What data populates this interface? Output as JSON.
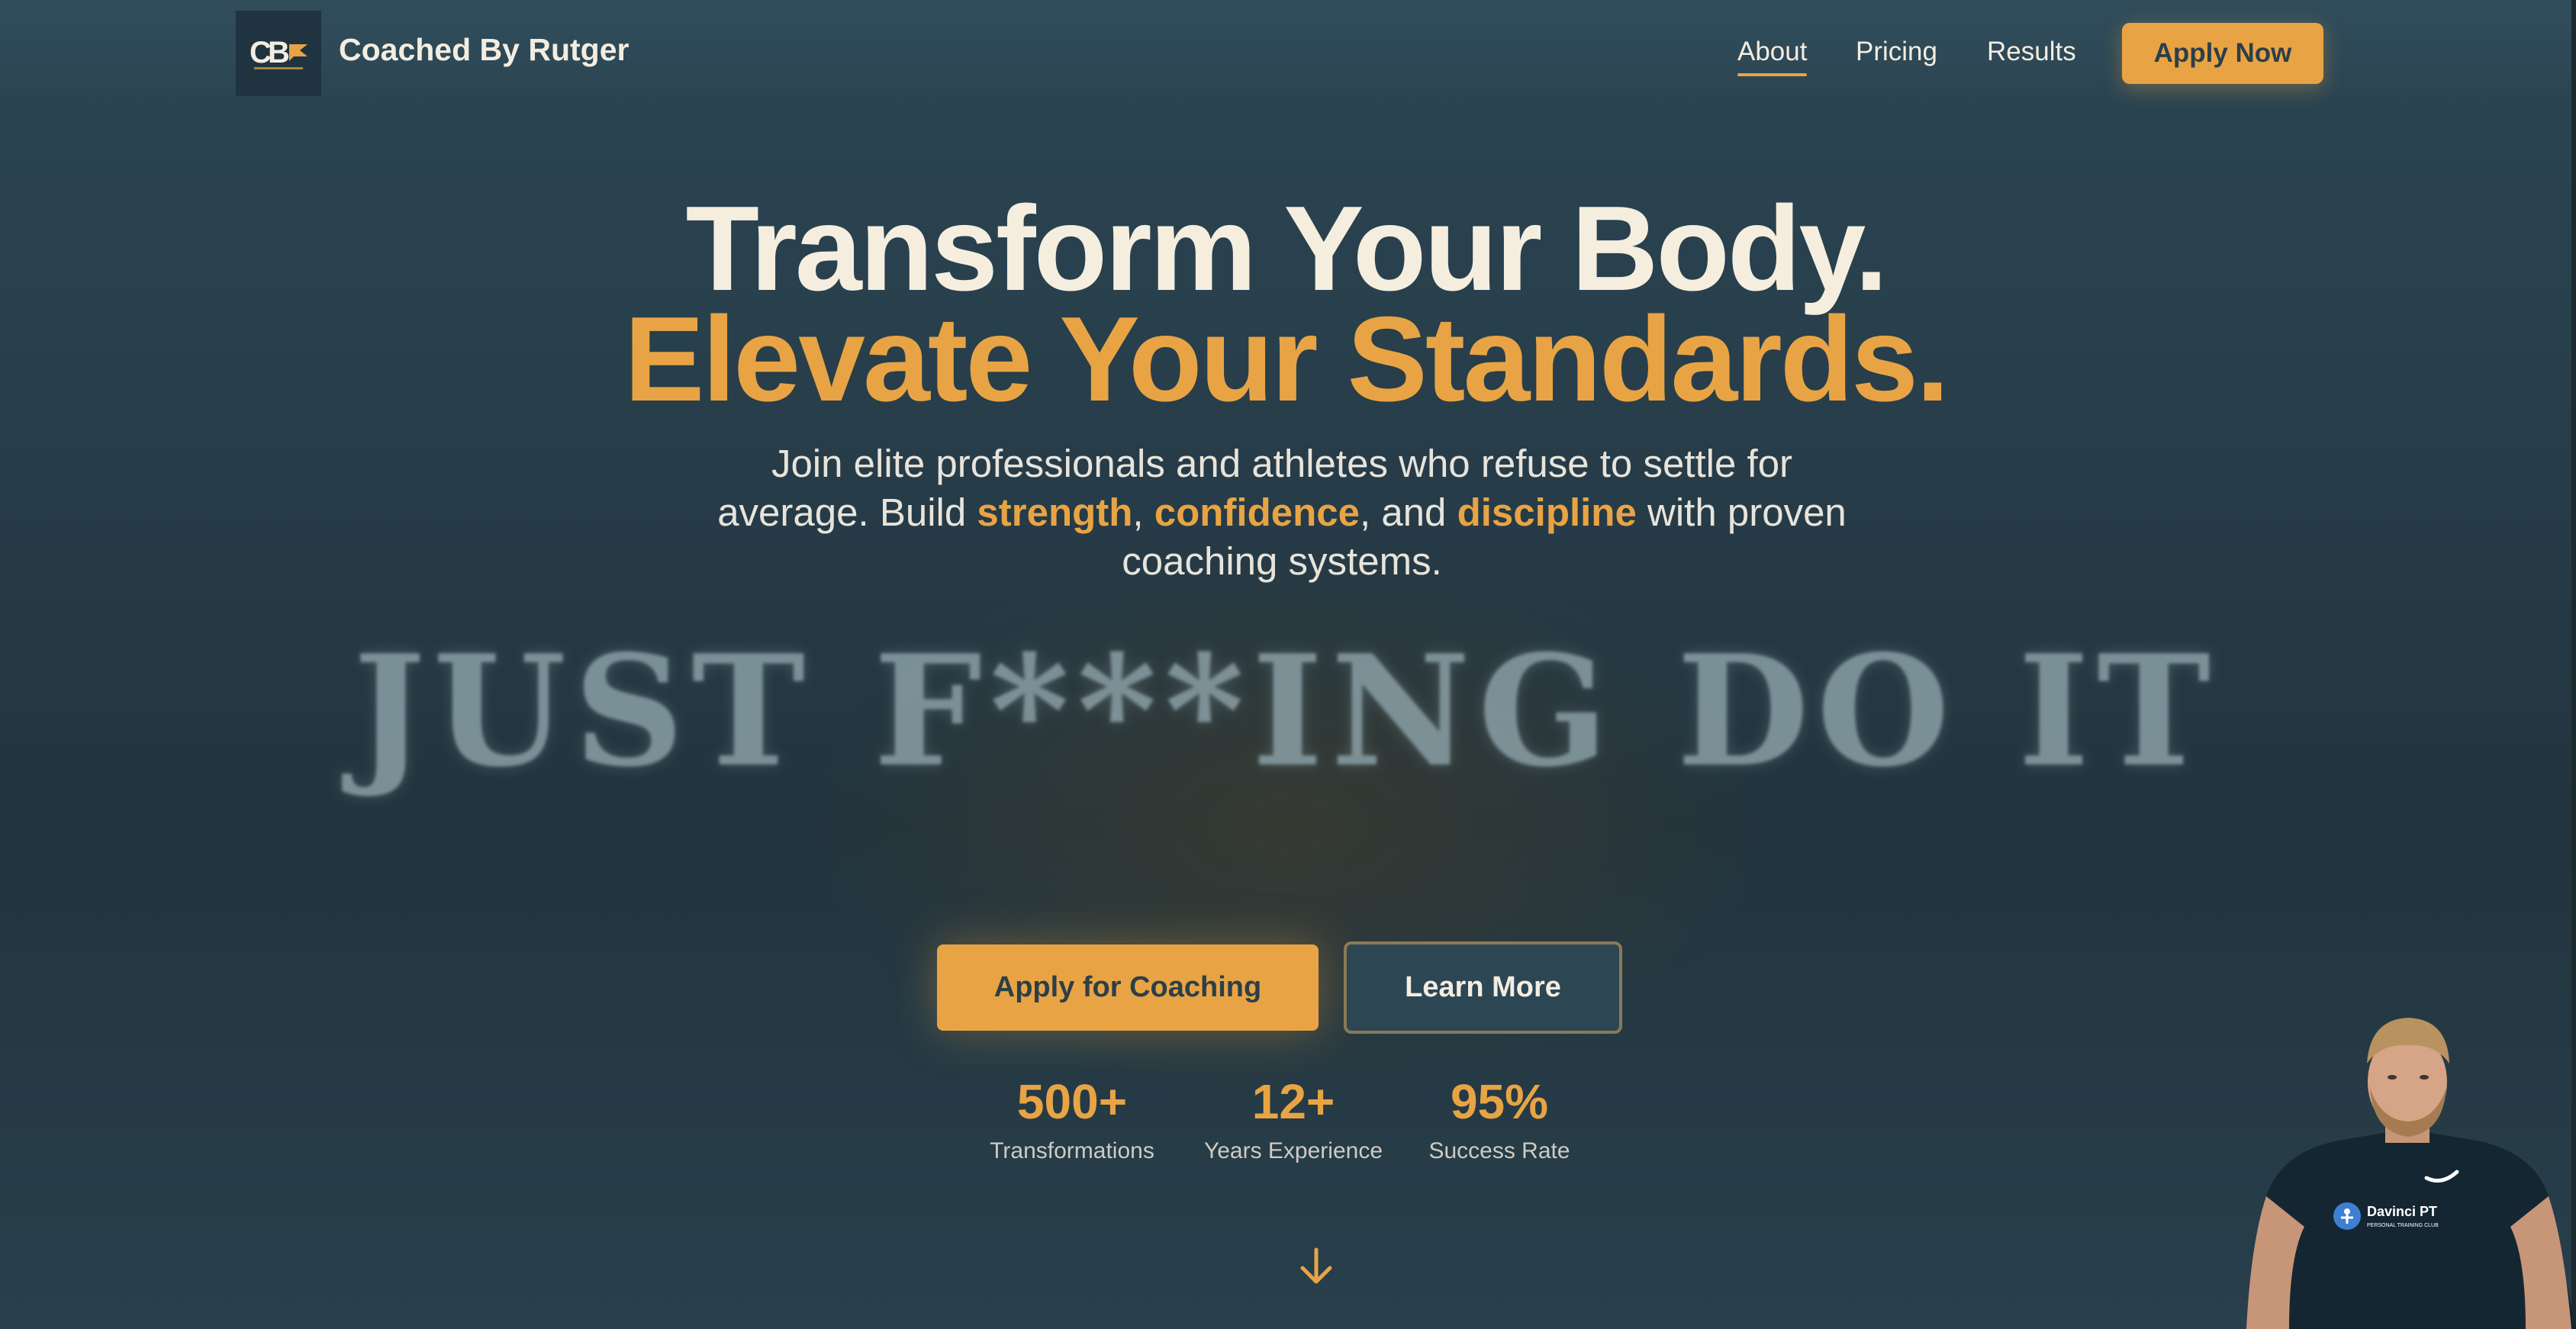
{
  "nav": {
    "logo_text": "CBR",
    "brand": "Coached By Rutger",
    "links": [
      {
        "label": "About",
        "active": true
      },
      {
        "label": "Pricing",
        "active": false
      },
      {
        "label": "Results",
        "active": false
      }
    ],
    "cta": "Apply Now"
  },
  "hero": {
    "title_line1": "Transform Your Body.",
    "title_line2": "Elevate Your Standards.",
    "subtitle": {
      "part1": "Join elite professionals and athletes who refuse to settle for average. Build ",
      "hl1": "strength",
      "sep1": ", ",
      "hl2": "confidence",
      "sep2": ", and ",
      "hl3": "discipline",
      "part2": " with proven coaching systems."
    },
    "motto": "JUST F***ING DO IT",
    "primary_button": "Apply for Coaching",
    "secondary_button": "Learn More"
  },
  "stats": [
    {
      "value": "500+",
      "label": "Transformations"
    },
    {
      "value": "12+",
      "label": "Years Experience"
    },
    {
      "value": "95%",
      "label": "Success Rate"
    }
  ],
  "coach": {
    "shirt_text": "Davinci PT",
    "shirt_subtext": "PERSONAL TRAINING CLUB"
  },
  "colors": {
    "accent": "#e8a444",
    "background": "#263b47",
    "text": "#f3ede0"
  },
  "icons": {
    "scroll": "arrow-down-icon",
    "logo": "cbr-logo-icon"
  }
}
